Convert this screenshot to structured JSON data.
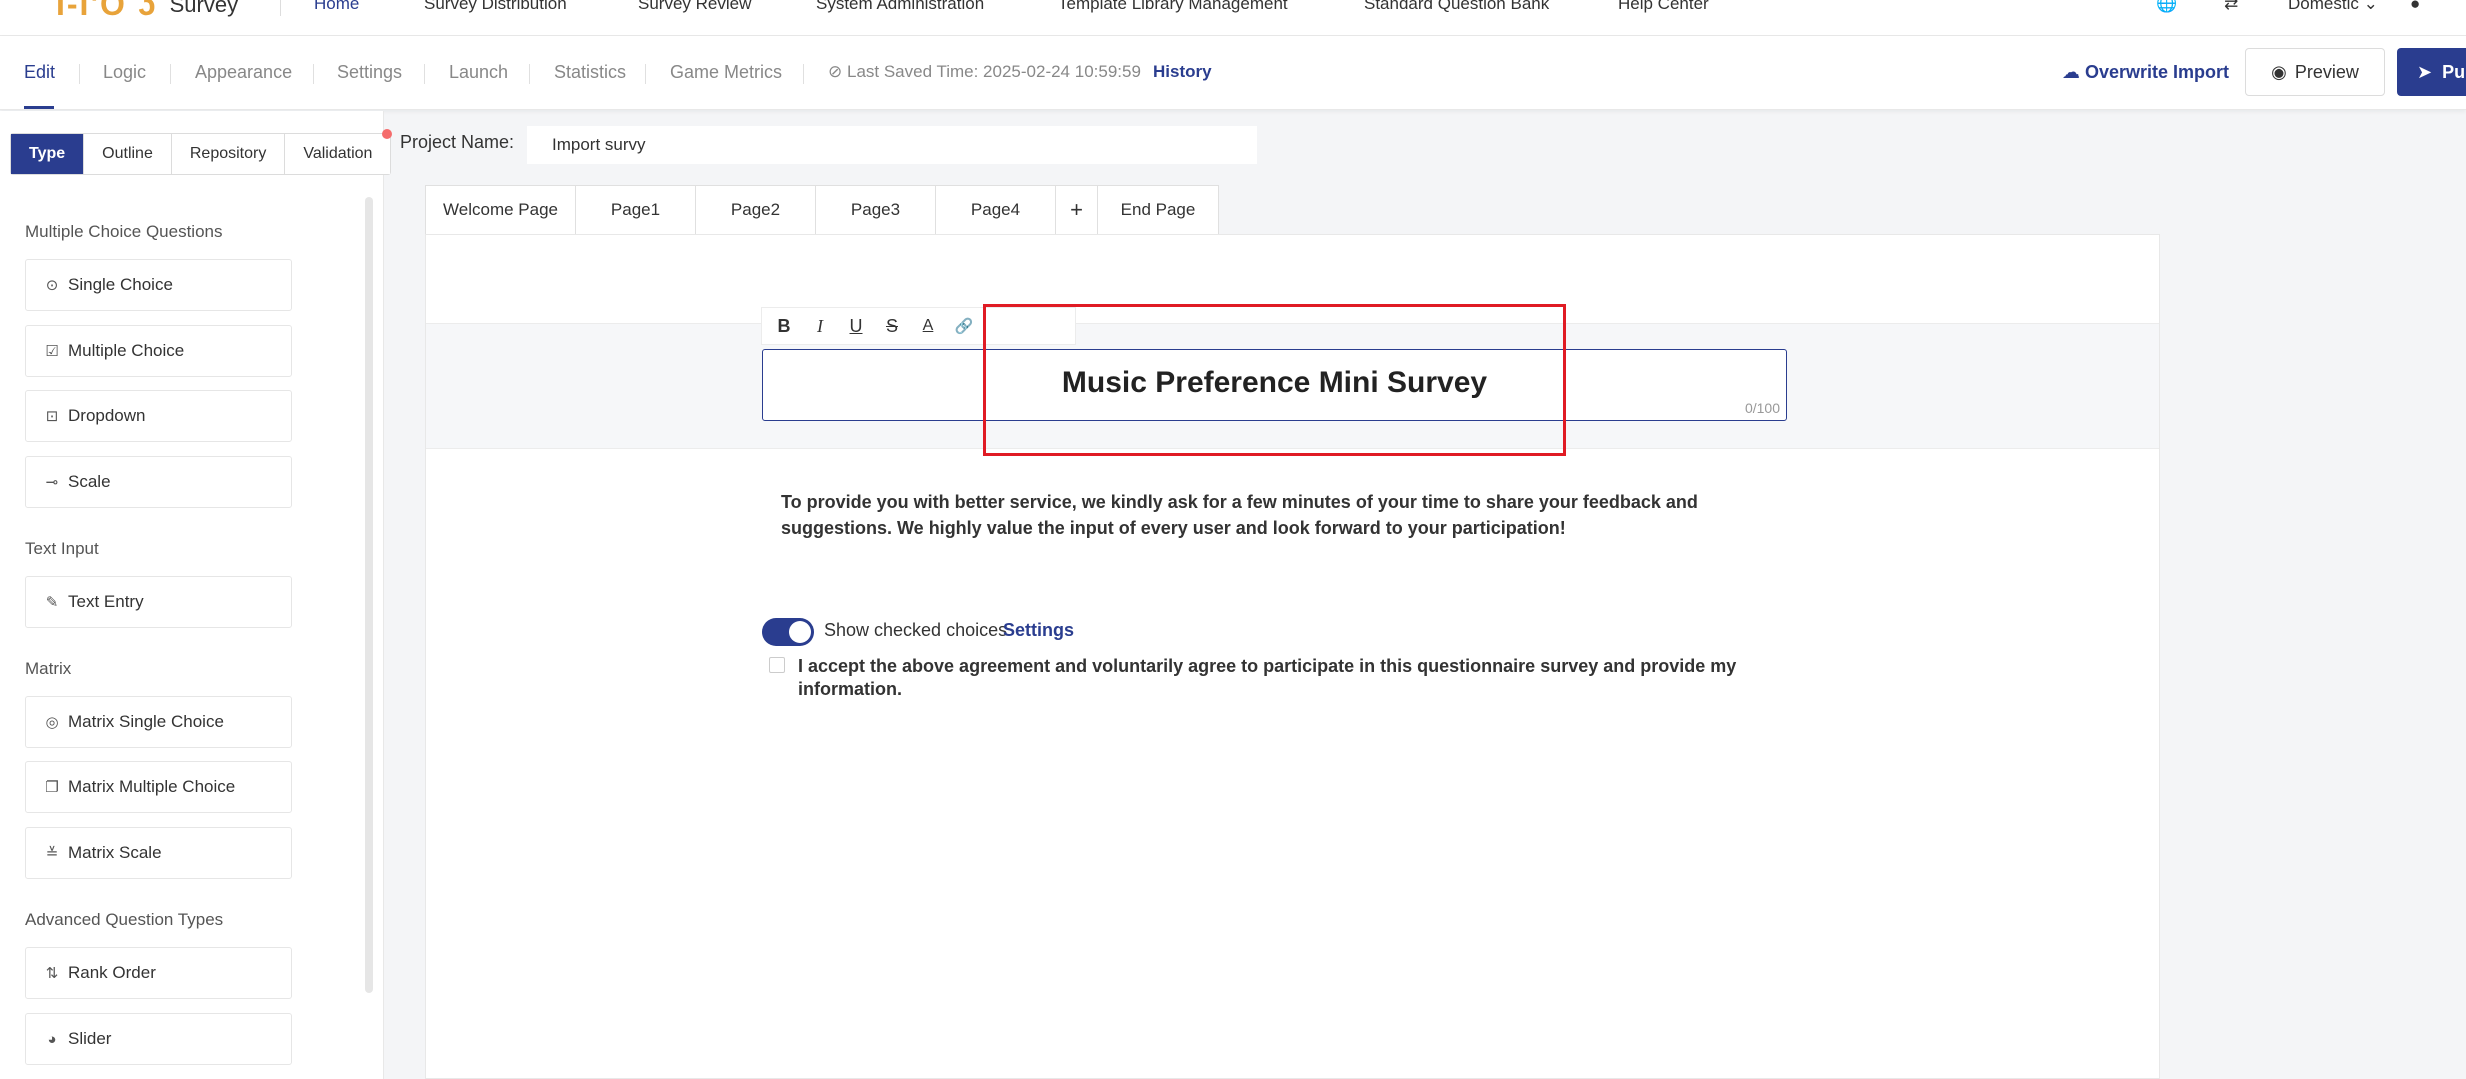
{
  "topnav": {
    "logo_mark": "I-I'O ʖ",
    "logo_text": "Survey",
    "items": [
      "Home",
      "Survey Distribution",
      "Survey Review",
      "System Administration",
      "Template Library Management",
      "Standard Question Bank",
      "Help Center"
    ],
    "active_item": "Home",
    "region": "Domestic"
  },
  "toolbar": {
    "tabs": [
      "Edit",
      "Logic",
      "Appearance",
      "Settings",
      "Launch",
      "Statistics",
      "Game Metrics"
    ],
    "active_tab": "Edit",
    "saved_label": "Last Saved Time: 2025-02-24 10:59:59",
    "history": "History",
    "overwrite_import": "Overwrite Import",
    "preview": "Preview",
    "publish": "Pu"
  },
  "sidebar": {
    "tabs": [
      "Type",
      "Outline",
      "Repository",
      "Validation"
    ],
    "active_tab": "Type",
    "groups": [
      {
        "title": "Multiple Choice Questions",
        "items": [
          {
            "label": "Single Choice",
            "icon": "radio-icon"
          },
          {
            "label": "Multiple Choice",
            "icon": "checkbox-icon"
          },
          {
            "label": "Dropdown",
            "icon": "dropdown-icon"
          },
          {
            "label": "Scale",
            "icon": "scale-icon"
          }
        ]
      },
      {
        "title": "Text Input",
        "items": [
          {
            "label": "Text Entry",
            "icon": "pencil-icon"
          }
        ]
      },
      {
        "title": "Matrix",
        "items": [
          {
            "label": "Matrix Single Choice",
            "icon": "matrix-single-icon"
          },
          {
            "label": "Matrix Multiple Choice",
            "icon": "matrix-multiple-icon"
          },
          {
            "label": "Matrix Scale",
            "icon": "sliders-icon"
          }
        ]
      },
      {
        "title": "Advanced Question Types",
        "items": [
          {
            "label": "Rank Order",
            "icon": "sort-icon"
          },
          {
            "label": "Slider",
            "icon": "slider-icon"
          }
        ]
      }
    ]
  },
  "project": {
    "label": "Project Name:",
    "value": "Import survy"
  },
  "pages": {
    "tabs": [
      "Welcome Page",
      "Page1",
      "Page2",
      "Page3",
      "Page4",
      "+",
      "End Page"
    ]
  },
  "editor": {
    "format_buttons": [
      "B",
      "I",
      "U",
      "S",
      "A",
      "🔗"
    ],
    "title": "Music Preference Mini Survey",
    "counter": "0/100",
    "description": "To provide you with better service, we kindly ask for a few minutes of your time to share your feedback and suggestions. We highly value the input of every user and look forward to your participation!",
    "show_checked_label": "Show checked choices",
    "settings_link": "Settings",
    "agreement": "I accept the above agreement and voluntarily agree to participate in this questionnaire survey and provide my information."
  },
  "colors": {
    "accent": "#2a3d8f",
    "highlight": "#e01b24"
  }
}
